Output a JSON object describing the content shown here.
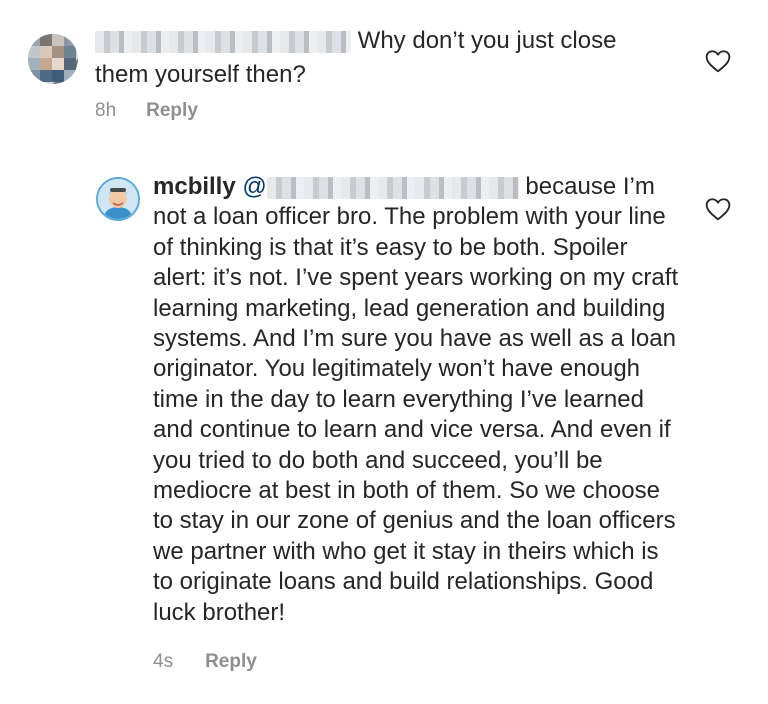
{
  "comments": [
    {
      "username_visible": false,
      "text": "Why don’t you just close them yourself then?",
      "time": "8h",
      "reply_label": "Reply"
    },
    {
      "username": "mcbilly",
      "mention_prefix": "@",
      "text": "because I’m not a loan officer bro. The problem with your line of thinking is that it’s easy to be both. Spoiler alert: it’s not. I’ve spent years working on my craft learning marketing, lead generation and building systems. And I’m sure you have as well as a loan originator. You legitimately won’t have enough time in the day to learn everything I’ve learned and continue to learn and vice versa. And even if you tried to do both and succeed, you’ll be mediocre at best in both of them. So we choose to stay in our zone of genius and the loan officers we partner with who get it stay in theirs which is to originate loans and build relationships. Good luck brother!",
      "time": "4s",
      "reply_label": "Reply"
    }
  ],
  "icons": {
    "like": "heart-outline-icon",
    "avatar_1": "blurred-avatar",
    "avatar_2": "user-avatar"
  },
  "colors": {
    "text": "#262626",
    "muted": "#8e8e8e",
    "mention": "#00376b"
  }
}
